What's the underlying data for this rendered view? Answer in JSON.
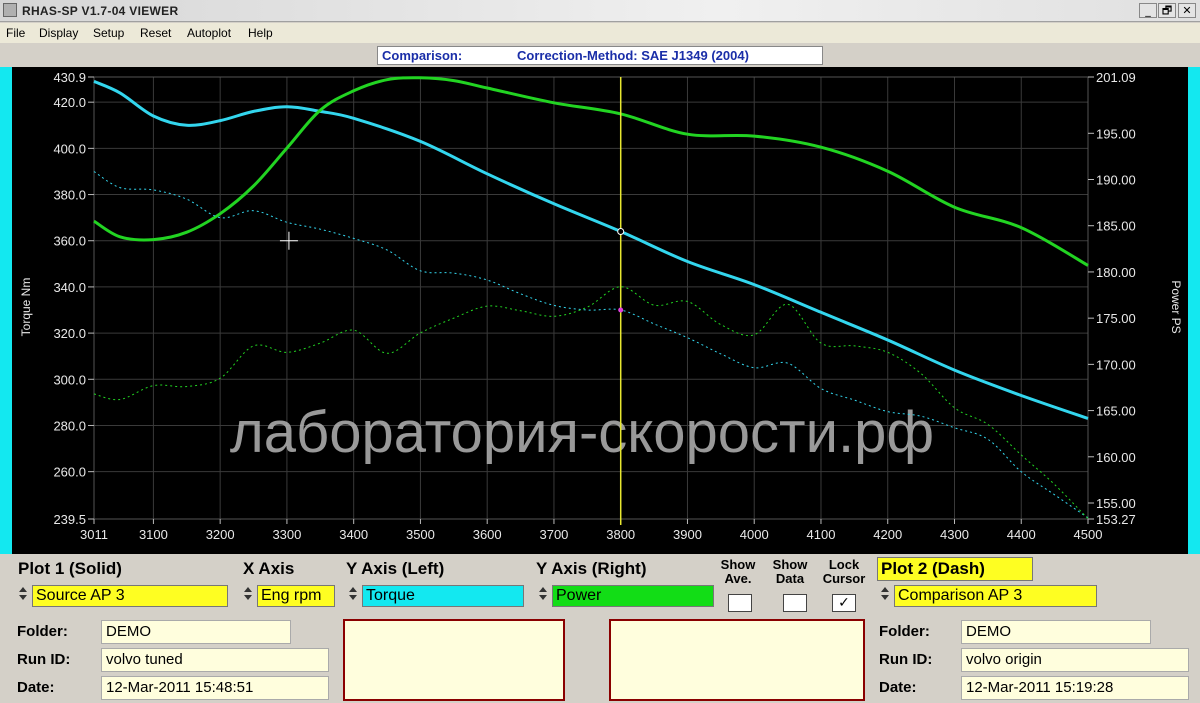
{
  "window": {
    "title": "RHAS-SP V1.7-04  VIEWER",
    "buttons": [
      "_",
      "🗗",
      "✕"
    ]
  },
  "menu": [
    "File",
    "Display",
    "Setup",
    "Reset",
    "Autoplot",
    "Help"
  ],
  "header": {
    "comparison": "Comparison:",
    "correction": "Correction-Method: SAE J1349 (2004)"
  },
  "chart_data": {
    "type": "line",
    "xlabel": "",
    "ylabel_left": "Torque Nm",
    "ylabel_right": "Power PS",
    "xlim": [
      3011,
      4500
    ],
    "ylim_left": [
      239.5,
      430.9
    ],
    "ylim_right": [
      153.27,
      201.09
    ],
    "x_ticks": [
      "3011",
      "3100",
      "3200",
      "3300",
      "3400",
      "3500",
      "3600",
      "3700",
      "3800",
      "3900",
      "4000",
      "4100",
      "4200",
      "4300",
      "4400",
      "4500"
    ],
    "y_ticks_left": [
      "430.9",
      "420.0",
      "400.0",
      "380.0",
      "360.0",
      "340.0",
      "320.0",
      "300.0",
      "280.0",
      "260.0",
      "239.5"
    ],
    "y_ticks_right": [
      "201.09",
      "195.00",
      "190.00",
      "185.00",
      "180.00",
      "175.00",
      "170.00",
      "165.00",
      "160.00",
      "155.00",
      "153.27"
    ],
    "grid": true,
    "cursor_x": 3800,
    "watermark": "лаборатория-скорости.рф",
    "colors": {
      "torque": "#33d6ee",
      "power": "#22d422",
      "cursor": "#e8e830",
      "grid": "#3a3a3a",
      "axis_text": "#e8e8e8"
    },
    "series": [
      {
        "name": "Torque",
        "axis": "left",
        "style": "solid",
        "color": "#33d6ee",
        "x": [
          3011,
          3050,
          3100,
          3150,
          3200,
          3250,
          3300,
          3350,
          3400,
          3500,
          3600,
          3700,
          3800,
          3900,
          4000,
          4100,
          4200,
          4300,
          4400,
          4500
        ],
        "y": [
          429,
          424,
          414,
          410,
          412,
          416,
          418,
          416,
          413,
          403,
          389,
          376,
          364,
          351,
          341,
          329,
          317,
          304,
          293,
          283
        ]
      },
      {
        "name": "Power",
        "axis": "right",
        "style": "solid",
        "color": "#22d422",
        "x": [
          3011,
          3050,
          3100,
          3150,
          3200,
          3250,
          3300,
          3350,
          3400,
          3450,
          3500,
          3550,
          3600,
          3700,
          3800,
          3900,
          4000,
          4100,
          4200,
          4300,
          4400,
          4500
        ],
        "y": [
          185.5,
          183.8,
          183.5,
          184.3,
          186.3,
          189.3,
          193.4,
          197.5,
          199.6,
          200.8,
          201.0,
          200.7,
          199.9,
          198.3,
          197.1,
          194.9,
          194.7,
          193.5,
          190.9,
          187.0,
          184.8,
          180.7
        ]
      },
      {
        "name": "Torque (Comparison)",
        "axis": "left",
        "style": "dash",
        "color": "#33d6ee",
        "x": [
          3011,
          3050,
          3100,
          3150,
          3200,
          3250,
          3300,
          3350,
          3400,
          3450,
          3500,
          3550,
          3600,
          3650,
          3700,
          3750,
          3800,
          3850,
          3900,
          3950,
          4000,
          4050,
          4100,
          4150,
          4200,
          4250,
          4300,
          4350,
          4400,
          4450,
          4500
        ],
        "y": [
          390,
          383,
          382,
          378,
          370,
          373,
          368,
          365,
          361,
          356,
          347,
          346,
          343,
          337,
          332,
          330,
          330,
          324,
          318,
          311,
          305,
          307,
          296,
          291,
          286,
          284,
          279,
          274,
          260,
          250,
          240
        ]
      },
      {
        "name": "Power (Comparison)",
        "axis": "right",
        "style": "dash",
        "color": "#22d422",
        "x": [
          3011,
          3050,
          3100,
          3150,
          3200,
          3250,
          3300,
          3350,
          3400,
          3450,
          3500,
          3550,
          3600,
          3650,
          3700,
          3750,
          3800,
          3850,
          3900,
          3950,
          4000,
          4050,
          4100,
          4150,
          4200,
          4250,
          4300,
          4350,
          4400,
          4450,
          4500
        ],
        "y": [
          166.8,
          166.2,
          167.7,
          167.6,
          168.5,
          172.0,
          171.3,
          172.3,
          173.7,
          171.2,
          173.4,
          175.0,
          176.3,
          175.8,
          175.2,
          176.2,
          178.4,
          176.4,
          176.8,
          174.3,
          173.2,
          176.5,
          172.3,
          172.0,
          171.3,
          169.0,
          165.3,
          163.5,
          160.2,
          157.0,
          153.3
        ]
      }
    ]
  },
  "panel": {
    "plot1_label": "Plot 1 (Solid)",
    "xaxis_label": "X Axis",
    "yleft_label": "Y Axis (Left)",
    "yright_label": "Y Axis (Right)",
    "show_ave": "Show Ave.",
    "show_data": "Show Data",
    "lock_cursor": "Lock Cursor",
    "plot2_label": "Plot 2 (Dash)",
    "source": "Source AP 3",
    "xaxis_value": "Eng rpm",
    "yleft_value": "Torque",
    "yright_value": "Power",
    "comparison": "Comparison AP 3",
    "lock_checked": "✓",
    "plot1": {
      "folder_label": "Folder:",
      "folder": "DEMO",
      "runid_label": "Run ID:",
      "runid": "volvo tuned",
      "date_label": "Date:",
      "date": "12-Mar-2011   15:48:51"
    },
    "plot2": {
      "folder_label": "Folder:",
      "folder": "DEMO",
      "runid_label": "Run ID:",
      "runid": "volvo origin",
      "date_label": "Date:",
      "date": "12-Mar-2011   15:19:28"
    }
  }
}
